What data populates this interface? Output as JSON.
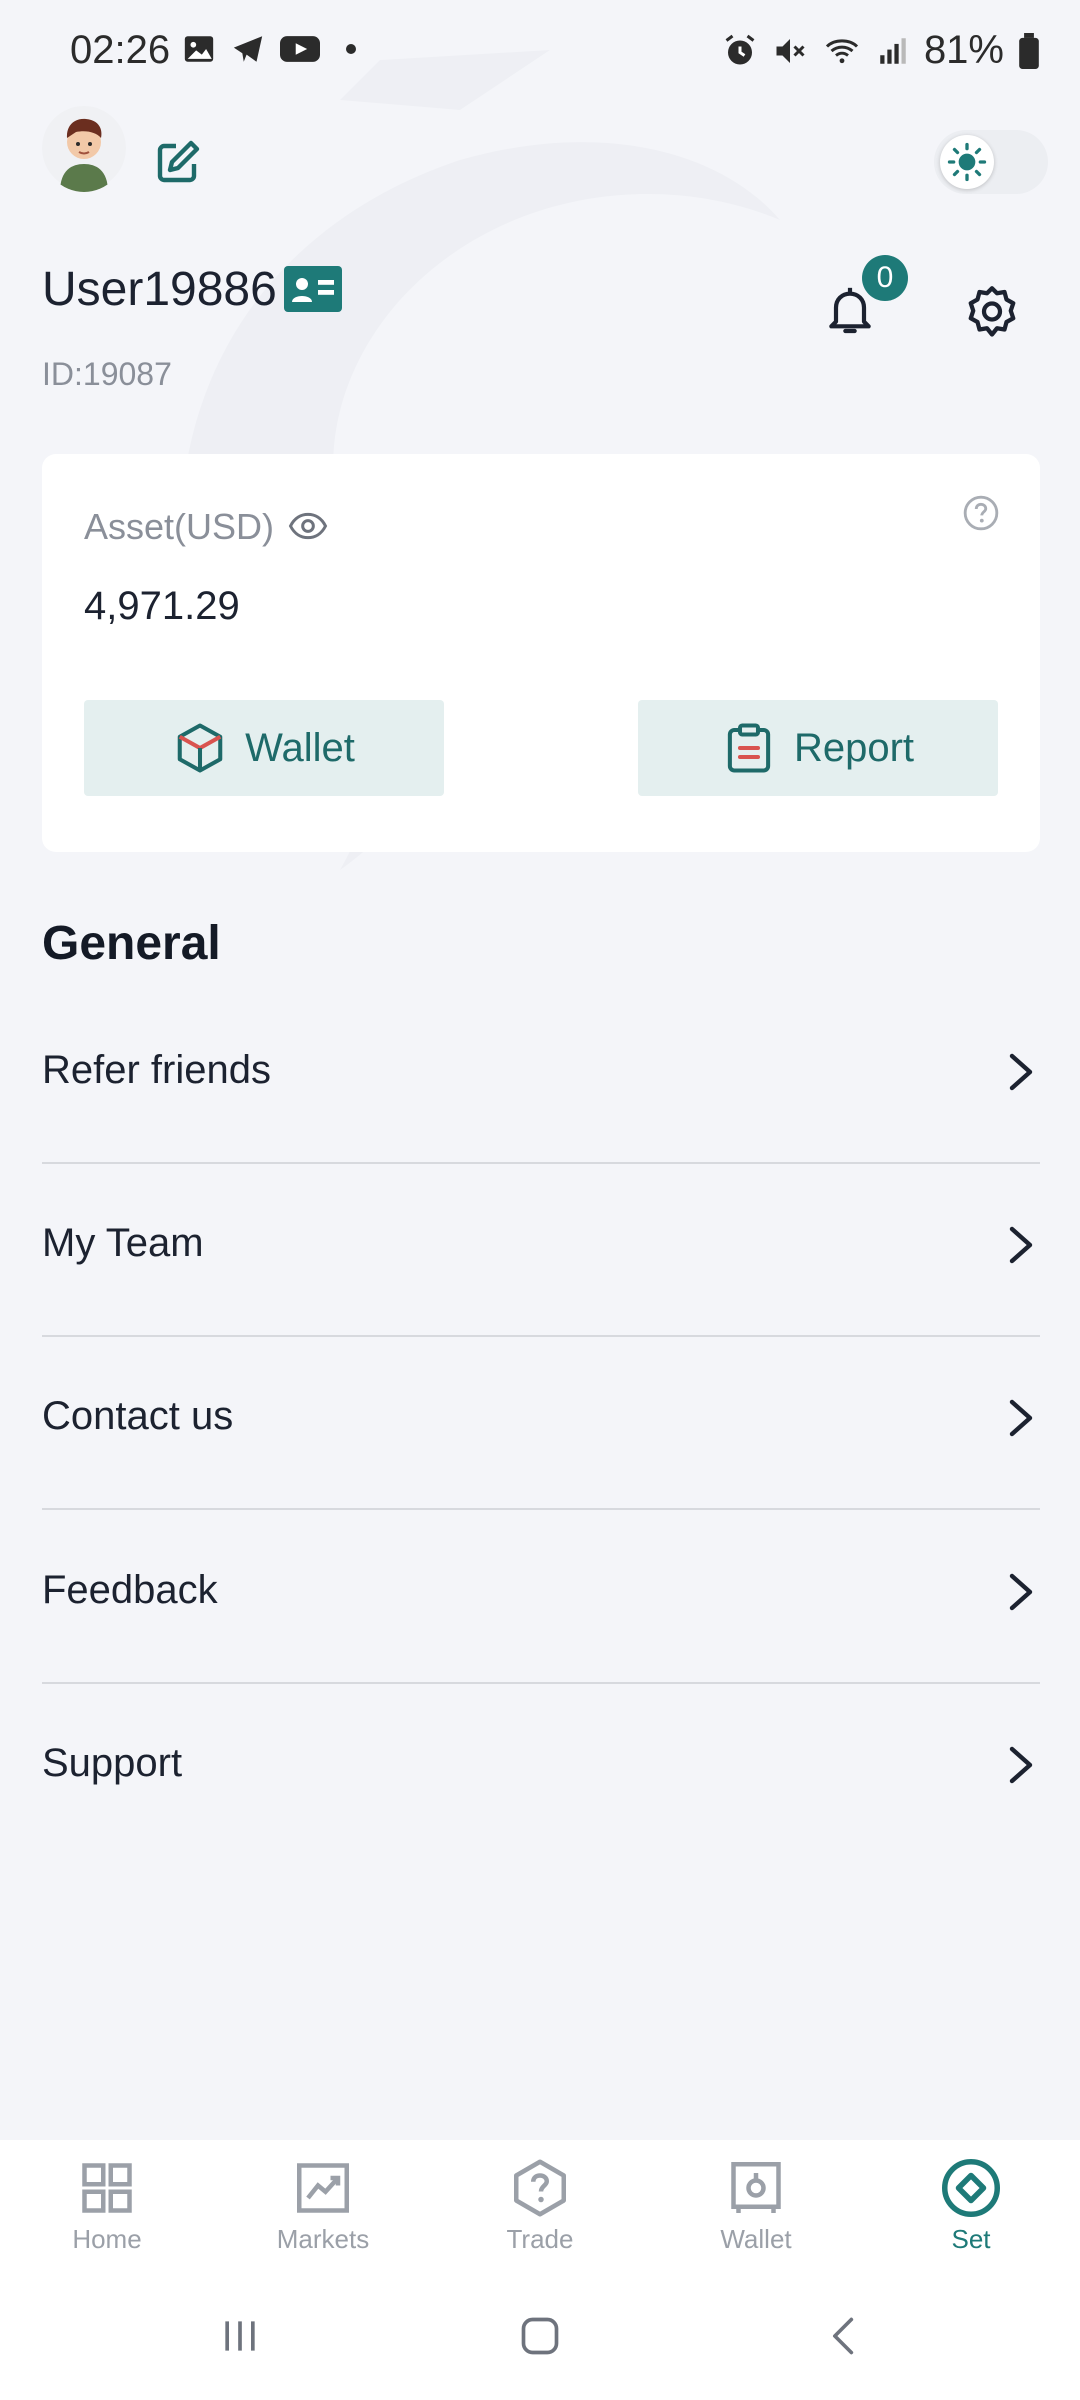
{
  "status_bar": {
    "time": "02:26",
    "battery": "81%"
  },
  "header": {
    "username": "User19886",
    "user_id": "ID:19087",
    "notification_count": "0"
  },
  "asset_card": {
    "label": "Asset(USD)",
    "value": "4,971.29",
    "wallet_label": "Wallet",
    "report_label": "Report"
  },
  "general": {
    "title": "General",
    "items": [
      {
        "label": "Refer friends"
      },
      {
        "label": "My Team"
      },
      {
        "label": "Contact us"
      },
      {
        "label": "Feedback"
      },
      {
        "label": "Support"
      }
    ]
  },
  "bottom_nav": {
    "items": [
      {
        "label": "Home",
        "icon": "grid-icon"
      },
      {
        "label": "Markets",
        "icon": "chart-icon"
      },
      {
        "label": "Trade",
        "icon": "question-hex-icon"
      },
      {
        "label": "Wallet",
        "icon": "safe-icon"
      },
      {
        "label": "Set",
        "icon": "diamond-circle-icon"
      }
    ],
    "active": "Set"
  },
  "colors": {
    "accent": "#1e7a78",
    "background": "#f4f5f9",
    "card": "#ffffff",
    "button_bg": "#e4efef",
    "muted_text": "#8a8f99"
  }
}
